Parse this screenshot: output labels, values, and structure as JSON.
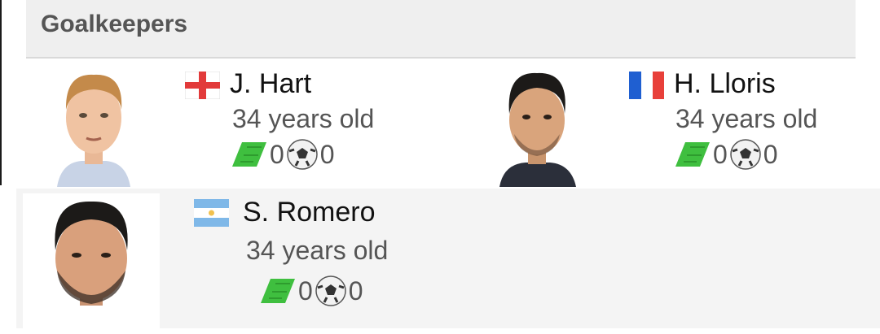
{
  "section": {
    "title": "Goalkeepers"
  },
  "players": [
    {
      "name": "J. Hart",
      "age_text": "34 years old",
      "country_flag": "england-flag-icon",
      "appearances": "0",
      "goals": "0"
    },
    {
      "name": "H. Lloris",
      "age_text": "34 years old",
      "country_flag": "france-flag-icon",
      "appearances": "0",
      "goals": "0"
    },
    {
      "name": "S. Romero",
      "age_text": "34 years old",
      "country_flag": "argentina-flag-icon",
      "appearances": "0",
      "goals": "0"
    }
  ],
  "colors": {
    "header_bg": "#efefef",
    "row_bg": "#f4f4f4",
    "pitch_green": "#3fbf3f"
  }
}
